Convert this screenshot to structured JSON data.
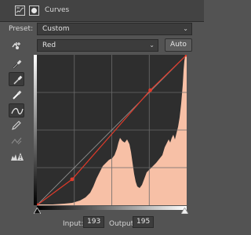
{
  "panel": {
    "title": "Curves",
    "icons": [
      "adjustment-layer-icon",
      "layer-mask-icon"
    ]
  },
  "preset": {
    "label": "Preset:",
    "value": "Custom"
  },
  "channel": {
    "value": "Red",
    "auto_label": "Auto"
  },
  "tools": [
    {
      "name": "on-image-adjust-icon",
      "active": false
    },
    {
      "name": "black-point-eyedropper-icon",
      "active": false
    },
    {
      "name": "gray-point-eyedropper-icon",
      "active": true
    },
    {
      "name": "white-point-eyedropper-icon",
      "active": false
    },
    {
      "name": "curve-edit-points-icon",
      "active": true
    },
    {
      "name": "pencil-draw-icon",
      "active": false
    },
    {
      "name": "smooth-curve-icon",
      "active": false
    },
    {
      "name": "clipping-warning-icon",
      "active": false
    }
  ],
  "curve": {
    "points": [
      [
        0,
        0
      ],
      [
        60,
        44
      ],
      [
        193,
        195
      ],
      [
        255,
        255
      ]
    ],
    "grid_divisions": 4
  },
  "io": {
    "input_label": "Input:",
    "input_value": "193",
    "output_label": "Output:",
    "output_value": "195"
  },
  "colors": {
    "histogram_fill": "#f7c0a6",
    "curve": "#e03a2a",
    "graph_bg": "#2e2e2e",
    "panel_bg": "#535353"
  }
}
